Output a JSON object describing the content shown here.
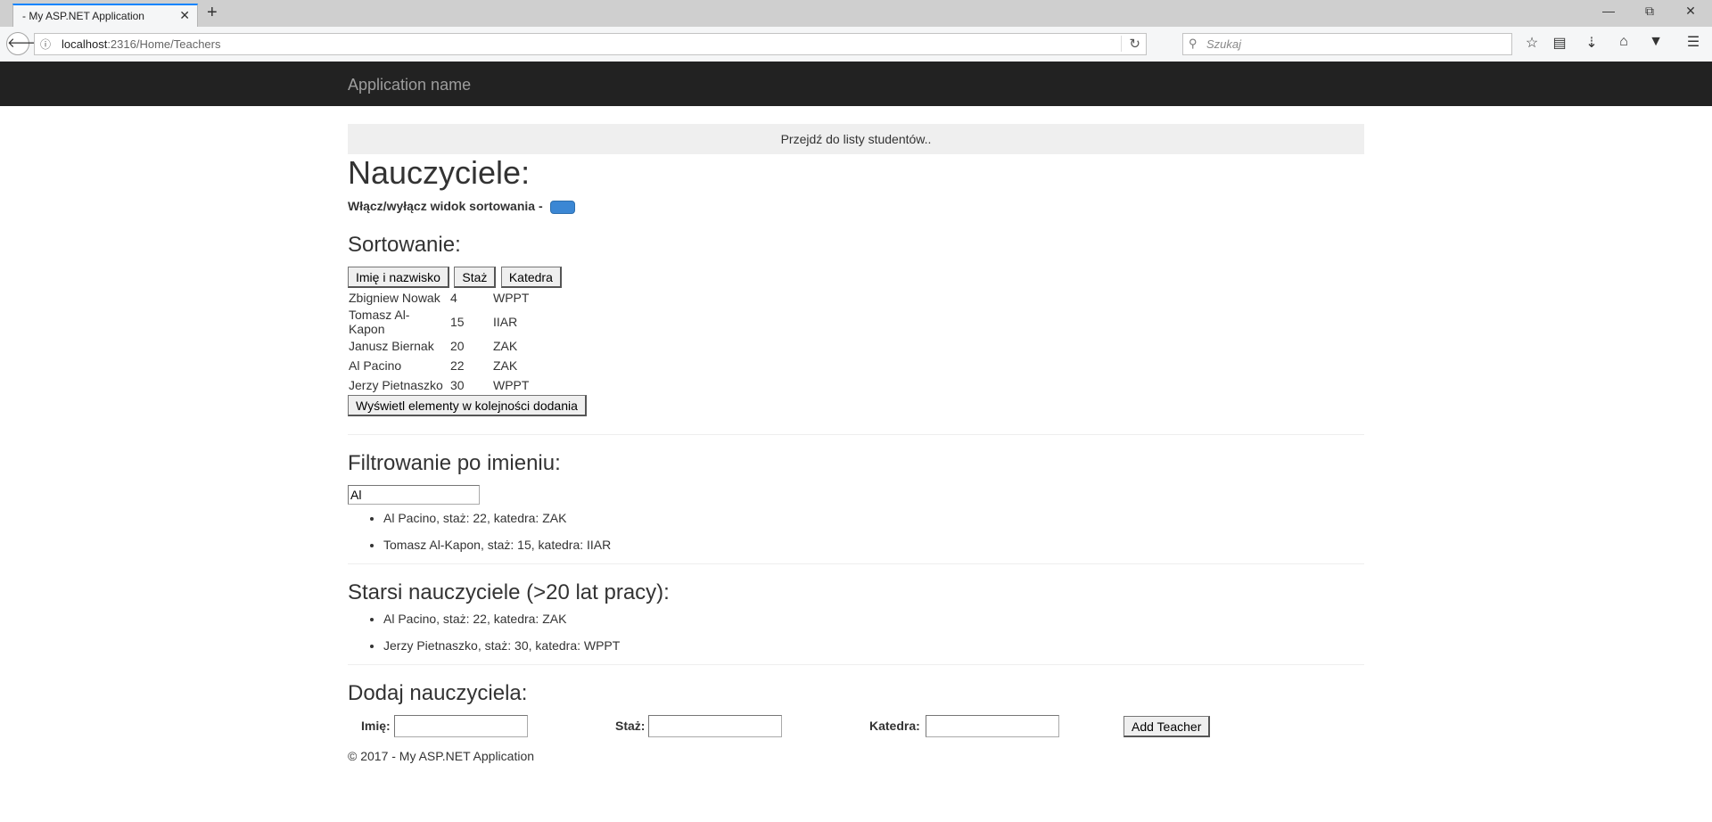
{
  "browser": {
    "tab_title": "- My ASP.NET Application",
    "tab_close": "✕",
    "new_tab": "+",
    "url_host": "localhost",
    "url_rest": ":2316/Home/Teachers",
    "search_placeholder": "Szukaj"
  },
  "site": {
    "brand": "Application name"
  },
  "page": {
    "goto_students": "Przejdź do listy studentów..",
    "title": "Nauczyciele:",
    "toggle_label": "Włącz/wyłącz widok sortowania -"
  },
  "sorting": {
    "heading": "Sortowanie:",
    "buttons": [
      "Imię i nazwisko",
      "Staż",
      "Katedra"
    ],
    "rows": [
      {
        "name": "Zbigniew Nowak",
        "staz": "4",
        "katedra": "WPPT"
      },
      {
        "name": "Tomasz Al-Kapon",
        "staz": "15",
        "katedra": "IIAR"
      },
      {
        "name": "Janusz Biernak",
        "staz": "20",
        "katedra": "ZAK"
      },
      {
        "name": "Al Pacino",
        "staz": "22",
        "katedra": "ZAK"
      },
      {
        "name": "Jerzy Pietnaszko",
        "staz": "30",
        "katedra": "WPPT"
      }
    ],
    "order_button": "Wyświetl elementy w kolejności dodania"
  },
  "filter": {
    "heading": "Filtrowanie po imieniu:",
    "value": "Al",
    "results": [
      "Al Pacino, staż: 22, katedra: ZAK",
      "Tomasz Al-Kapon, staż: 15, katedra: IIAR"
    ]
  },
  "senior": {
    "heading": "Starsi nauczyciele (>20 lat pracy):",
    "items": [
      "Al Pacino, staż: 22, katedra: ZAK",
      "Jerzy Pietnaszko, staż: 30, katedra: WPPT"
    ]
  },
  "add": {
    "heading": "Dodaj nauczyciela:",
    "name_label": "Imię:",
    "staz_label": "Staż:",
    "katedra_label": "Katedra:",
    "button": "Add Teacher"
  },
  "footer": "© 2017 - My ASP.NET Application"
}
